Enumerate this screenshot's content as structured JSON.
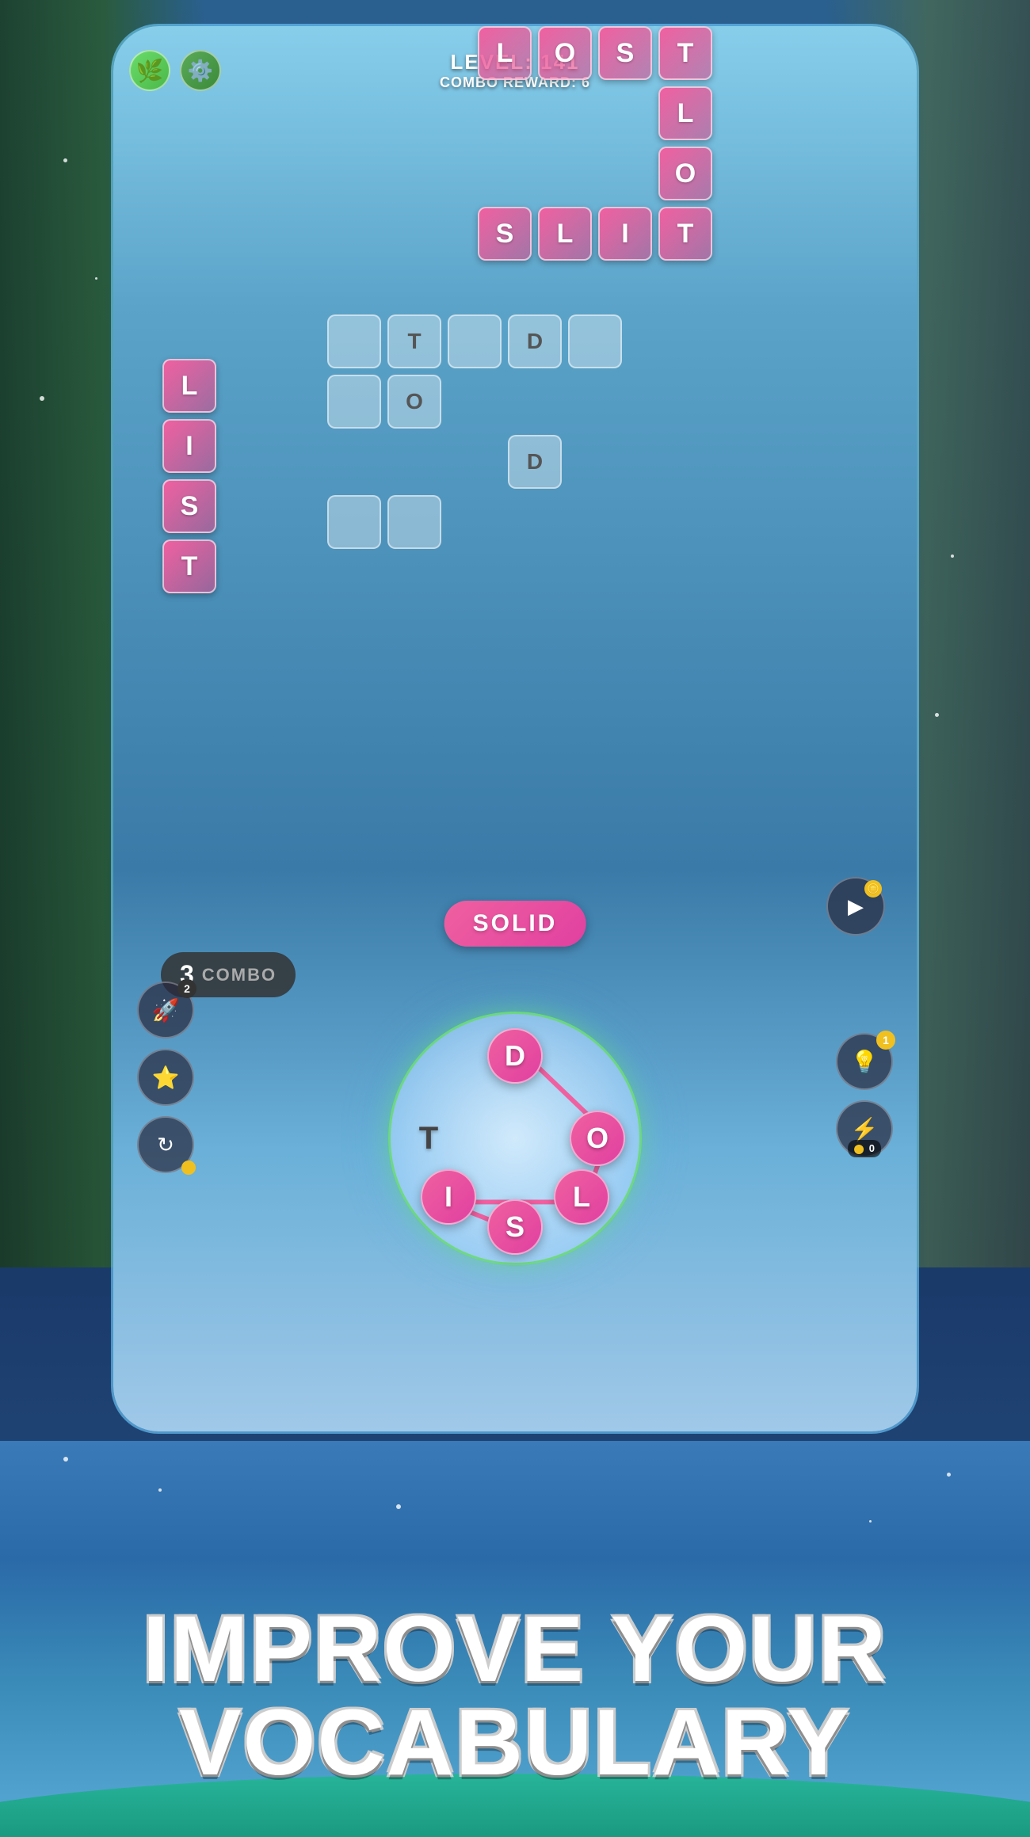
{
  "header": {
    "level_label": "LEVEL: 141",
    "combo_reward_label": "COMBO REWARD: 6",
    "leaf_icon": "leaf",
    "gear_icon": "gear"
  },
  "crossword": {
    "lost_word": [
      "L",
      "O",
      "S",
      "T"
    ],
    "slit_word": [
      "S",
      "L",
      "I",
      "T"
    ],
    "list_word": [
      "L",
      "I",
      "S",
      "T"
    ],
    "middle_letters": {
      "T": "T",
      "D1": "D",
      "O": "O",
      "D2": "D"
    }
  },
  "combo": {
    "number": "3",
    "label": "COMBO"
  },
  "word_display": {
    "word": "SOLID"
  },
  "wheel": {
    "letters": {
      "D": "D",
      "T": "T",
      "O": "O",
      "I": "I",
      "L": "L",
      "S": "S"
    }
  },
  "side_buttons": {
    "rocket_count": "2",
    "bulb_count": "1",
    "bolt_count": "0"
  },
  "bottom": {
    "line1": "IMPROVE YOUR",
    "line2": "VOCABULARY"
  }
}
